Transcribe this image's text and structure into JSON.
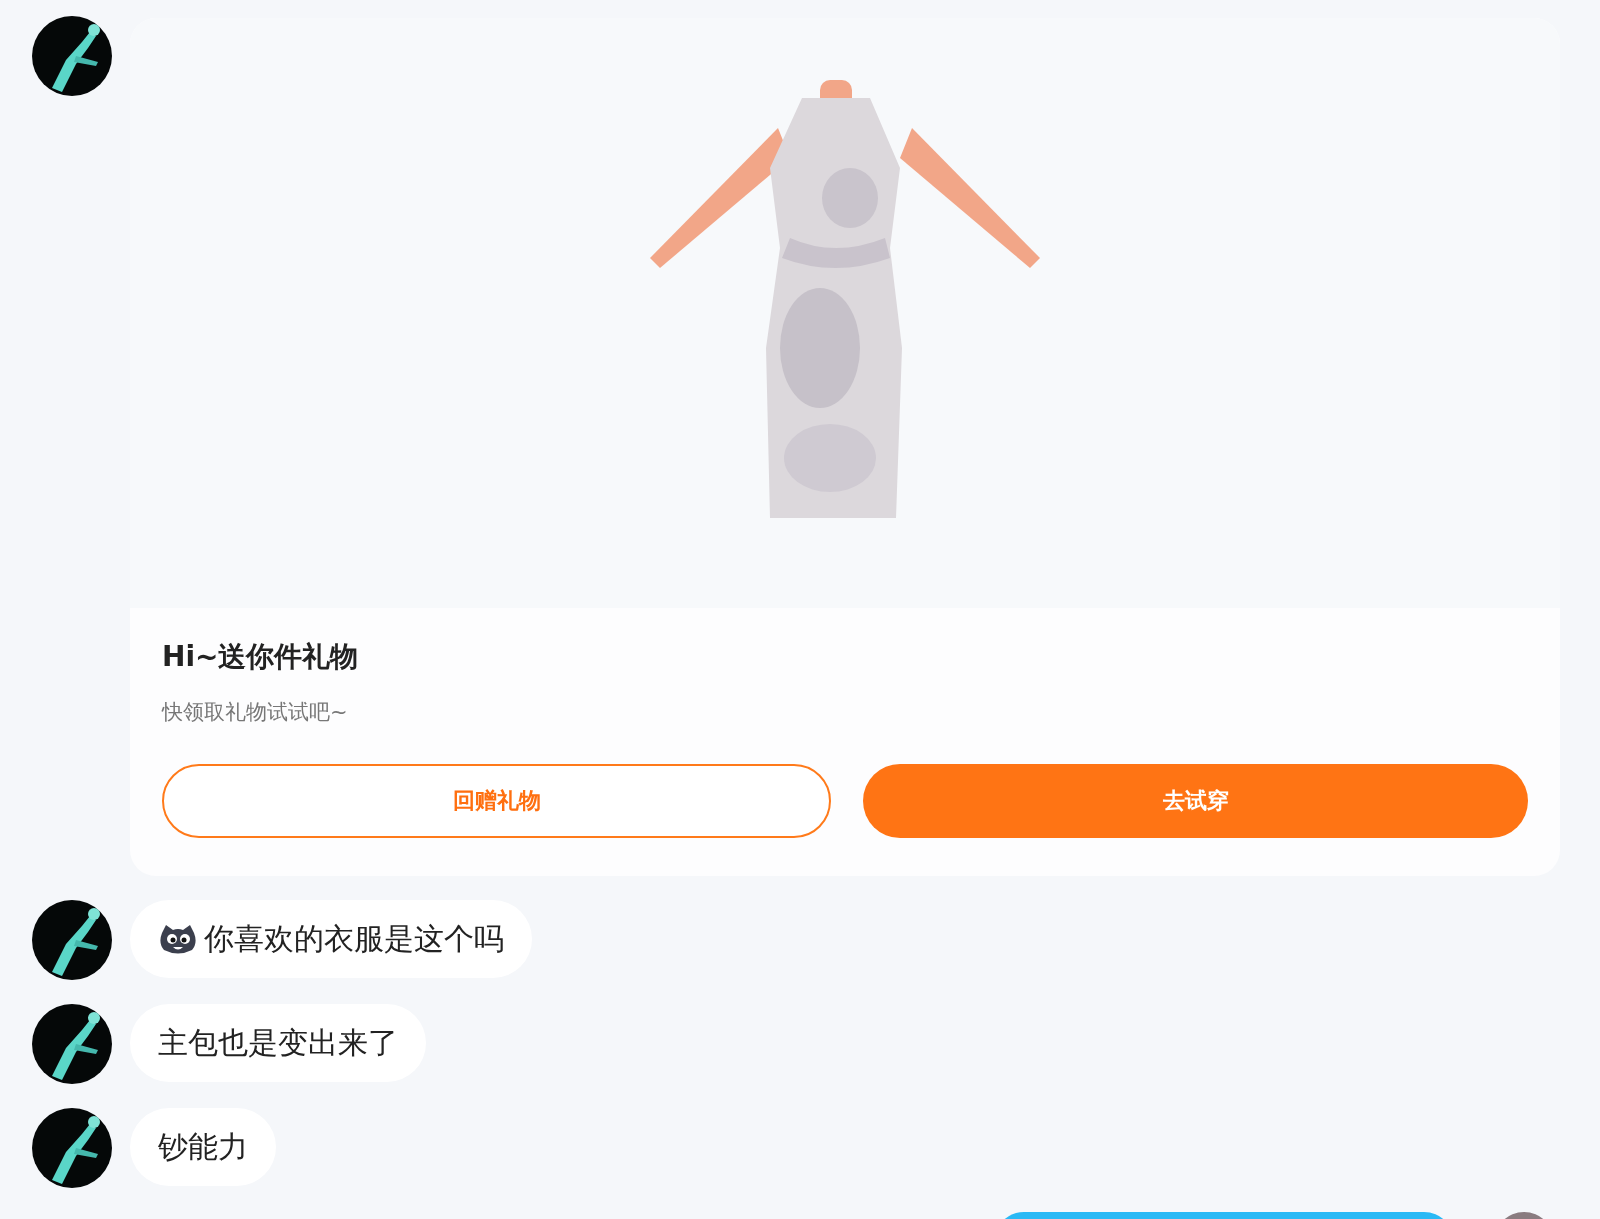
{
  "messages": [
    {
      "kind": "gift",
      "outgoing": false,
      "title": "Hi~送你件礼物",
      "subtitle": "快领取礼物试试吧~",
      "buttons": [
        {
          "label": "回赠礼物",
          "kind": "outline"
        },
        {
          "label": "去试穿",
          "kind": "filled"
        }
      ]
    },
    {
      "kind": "text",
      "outgoing": false,
      "emoji": true,
      "text": "你喜欢的衣服是这个吗"
    },
    {
      "kind": "text",
      "outgoing": false,
      "emoji": false,
      "text": "主包也是变出来了"
    },
    {
      "kind": "text",
      "outgoing": false,
      "emoji": false,
      "text": "钞能力"
    },
    {
      "kind": "cut_off",
      "outgoing": true
    }
  ]
}
